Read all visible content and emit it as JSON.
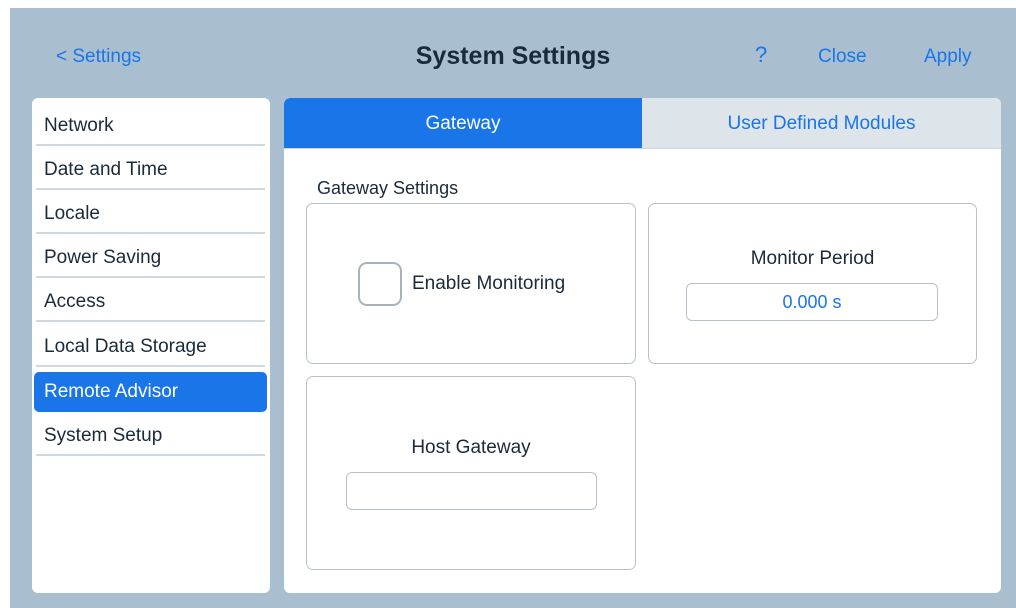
{
  "header": {
    "back_label": "< Settings",
    "title": "System Settings",
    "help_label": "?",
    "close_label": "Close",
    "apply_label": "Apply"
  },
  "sidebar": {
    "items": [
      {
        "label": "Network"
      },
      {
        "label": "Date and Time"
      },
      {
        "label": "Locale"
      },
      {
        "label": "Power Saving"
      },
      {
        "label": "Access"
      },
      {
        "label": "Local Data Storage"
      },
      {
        "label": "Remote Advisor",
        "active": true
      },
      {
        "label": "System Setup"
      }
    ]
  },
  "tabs": [
    {
      "label": "Gateway",
      "active": true
    },
    {
      "label": "User Defined Modules",
      "active": false
    }
  ],
  "gateway": {
    "section_title": "Gateway Settings",
    "enable_monitoring": {
      "label": "Enable Monitoring",
      "checked": false
    },
    "monitor_period": {
      "label": "Monitor Period",
      "value": "0.000 s"
    },
    "host_gateway": {
      "label": "Host Gateway",
      "value": ""
    }
  },
  "colors": {
    "accent": "#1a75e8",
    "background": "#a9bfcf",
    "title_text": "#172a3f",
    "tab_inactive_bg": "#dde5eb"
  }
}
